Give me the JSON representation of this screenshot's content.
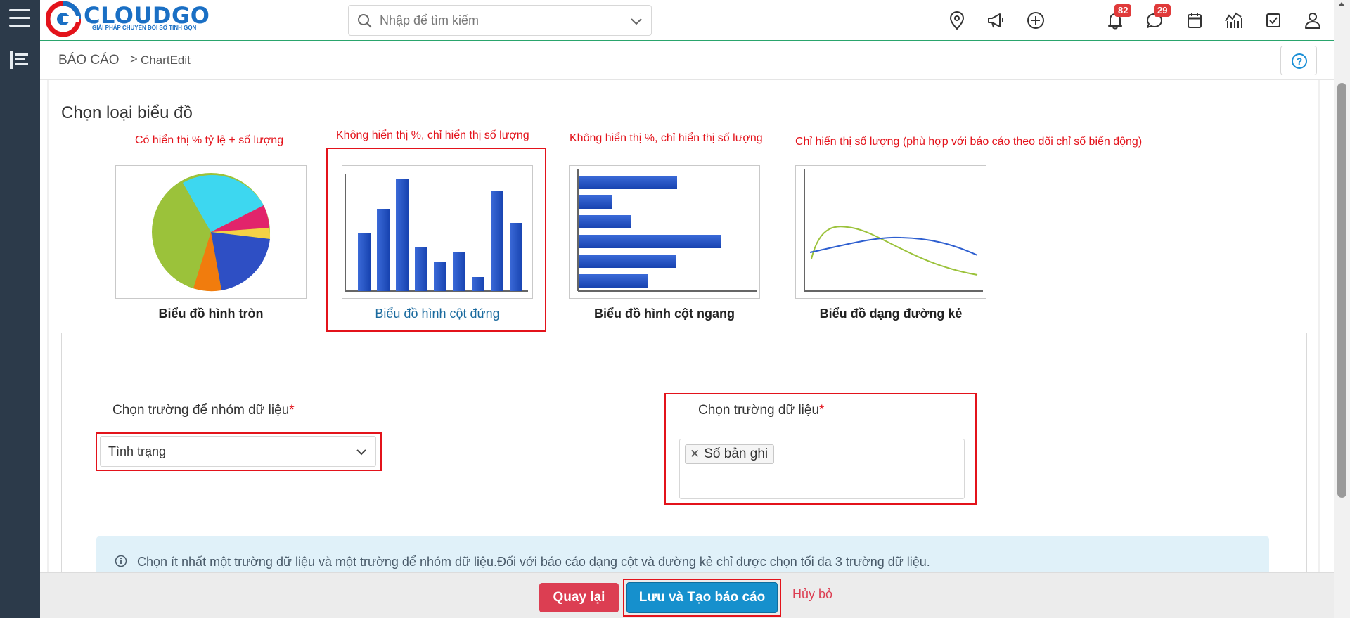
{
  "topbar": {
    "logo_name": "CLOUDGO",
    "logo_slogan": "GIẢI PHÁP CHUYỂN ĐỔI SỐ TINH GỌN",
    "search_placeholder": "Nhập để tìm kiếm",
    "notifications_count": "82",
    "messages_count": "29"
  },
  "breadcrumb": {
    "root": "BÁO CÁO",
    "separator": ">",
    "current": "ChartEdit"
  },
  "section": {
    "title": "Chọn loại biểu đồ"
  },
  "chart_types": [
    {
      "note": "Có hiển thị % tỷ lệ + số lượng",
      "label": "Biểu đồ hình tròn",
      "icon": "pie-chart-icon"
    },
    {
      "note": "Không hiển thị %, chỉ hiển thị số lượng",
      "label": "Biểu đồ hình cột đứng",
      "icon": "column-chart-icon",
      "selected": true
    },
    {
      "note": "Không hiển thị %, chỉ hiển thị số lượng",
      "label": "Biểu đồ hình cột ngang",
      "icon": "bar-chart-icon"
    },
    {
      "note": "Chỉ hiển thị số lượng (phù hợp với báo cáo theo dõi chỉ số biến động)",
      "label": "Biểu đồ dạng đường kẻ",
      "icon": "line-chart-icon"
    }
  ],
  "form": {
    "group_field_label": "Chọn trường để nhóm dữ liệu",
    "group_field_value": "Tình trạng",
    "data_field_label": "Chọn trường dữ liệu",
    "data_field_tags": [
      "Số bản ghi"
    ],
    "required_mark": "*"
  },
  "info": {
    "text": "Chọn ít nhất một trường dữ liệu và một trường để nhóm dữ liệu.Đối với báo cáo dạng cột và đường kẻ chỉ được chọn tối đa 3 trường dữ liệu."
  },
  "footer": {
    "back_label": "Quay lại",
    "save_label": "Lưu và Tạo báo cáo",
    "cancel_label": "Hủy bỏ"
  },
  "colors": {
    "sidebar": "#2c3a4a",
    "highlight": "#e3131b",
    "primary": "#1690cd",
    "danger": "#dc3e52"
  }
}
